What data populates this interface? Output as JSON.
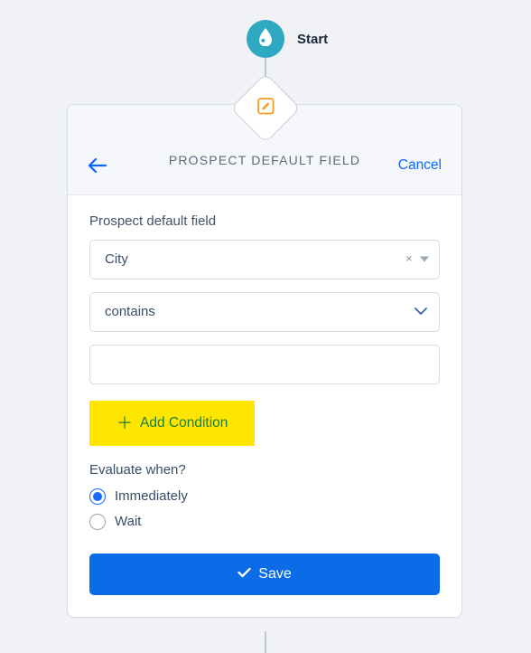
{
  "start": {
    "label": "Start"
  },
  "card": {
    "title": "PROSPECT DEFAULT FIELD",
    "cancel": "Cancel"
  },
  "form": {
    "field_label": "Prospect default field",
    "field_value": "City",
    "operator_value": "contains",
    "value_input": "",
    "add_condition": "Add Condition",
    "evaluate_label": "Evaluate when?",
    "options": {
      "immediately": "Immediately",
      "wait": "Wait"
    },
    "selected_option": "immediately",
    "save": "Save"
  }
}
